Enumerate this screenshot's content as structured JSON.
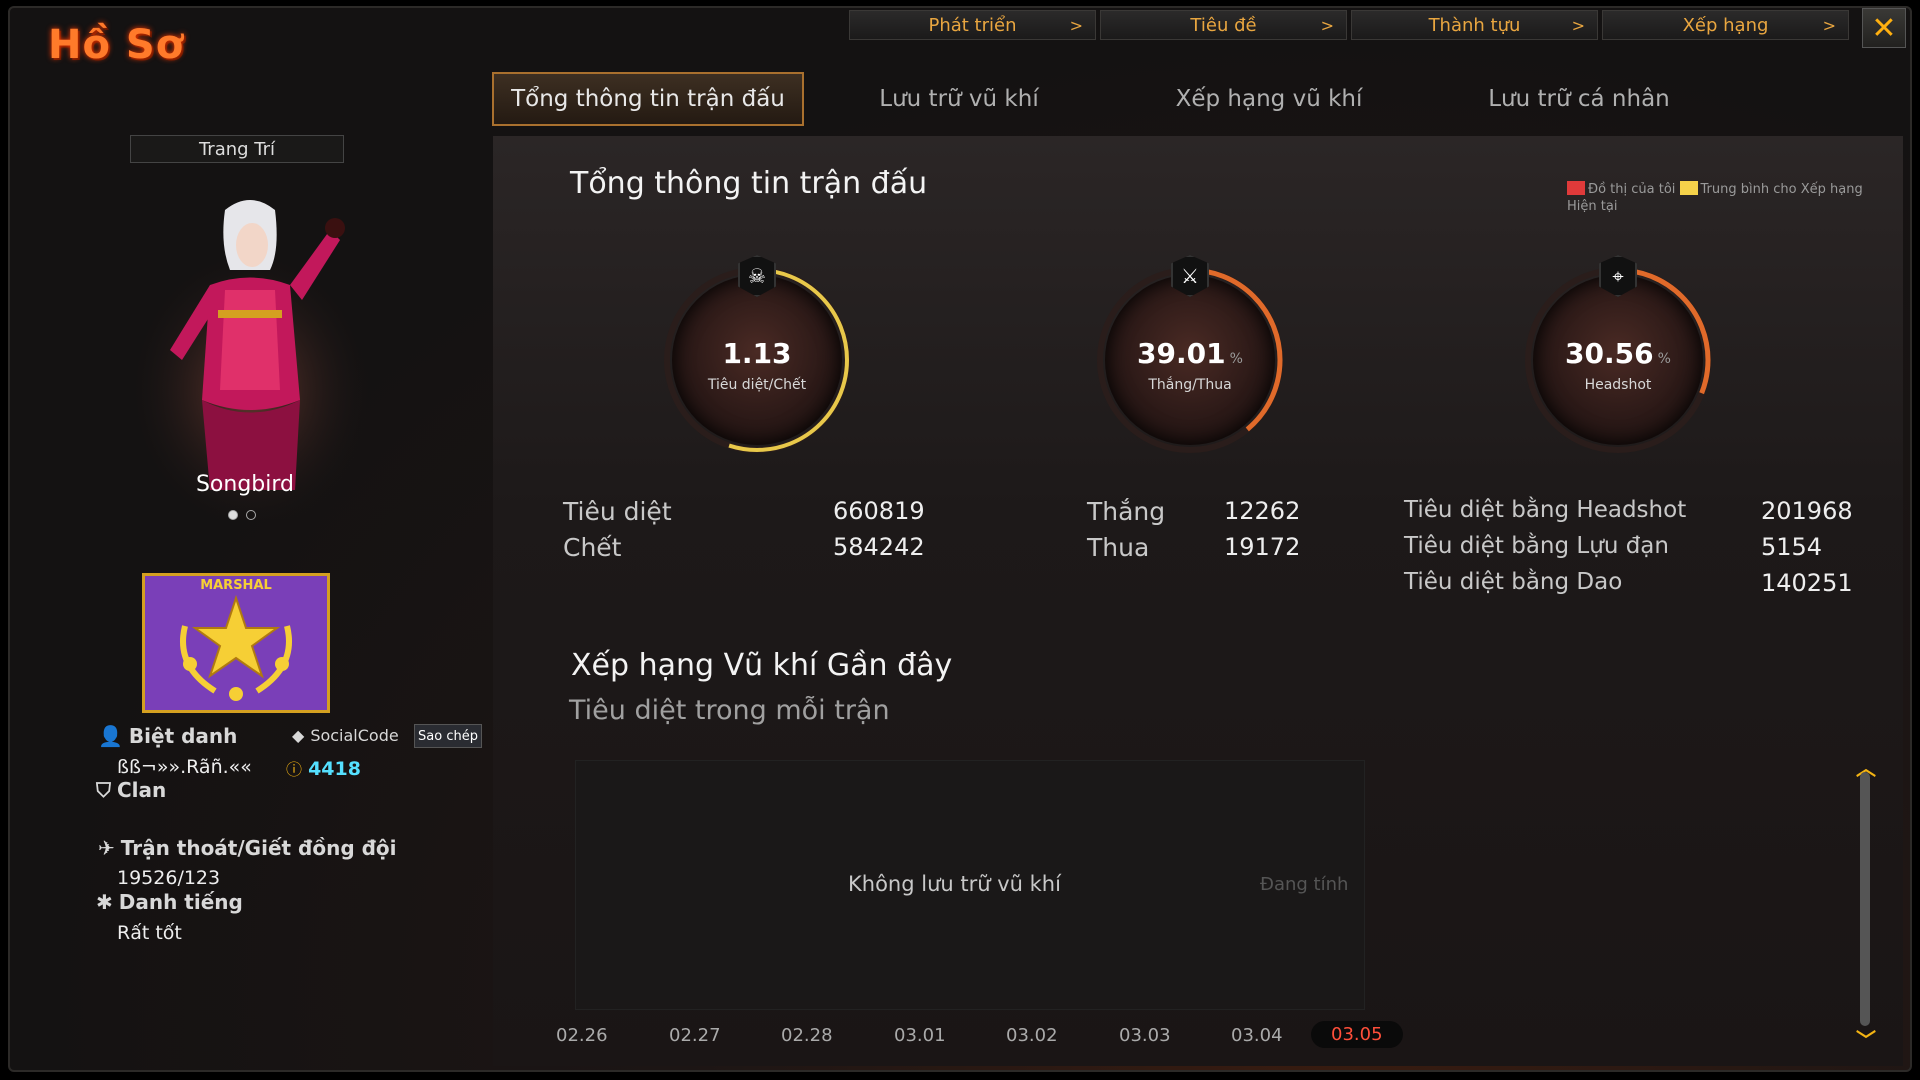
{
  "window": {
    "title": "Hồ Sơ",
    "close_label": "✕"
  },
  "topnav": [
    {
      "label": "Phát triển"
    },
    {
      "label": "Tiêu đề"
    },
    {
      "label": "Thành tựu"
    },
    {
      "label": "Xếp hạng"
    }
  ],
  "tabs": [
    {
      "label": "Tổng thông tin trận đấu",
      "active": true
    },
    {
      "label": "Lưu trữ vũ khí"
    },
    {
      "label": "Xếp hạng vũ khí"
    },
    {
      "label": "Lưu trữ cá nhân"
    }
  ],
  "profile": {
    "decorate_button": "Trang Trí",
    "character_name": "Songbird",
    "rank_badge": "MARSHAL",
    "nickname_label": "Biệt danh",
    "nickname": "ßß¬»».Rãñ.««",
    "socialcode_label": "SocialCode",
    "copy_label": "Sao chép",
    "socialcode": "4418",
    "clan_label": "Clan",
    "escape_label": "Trận thoát/Giết đồng đội",
    "escape_value": "19526/123",
    "reputation_label": "Danh tiếng",
    "reputation_value": "Rất tốt"
  },
  "summary": {
    "title": "Tổng thông tin trận đấu",
    "legend": {
      "mine": "Đồ thị của tôi",
      "avg": "Trung bình cho Xếp hạng Hiện tại",
      "mine_color": "#e03a3a",
      "avg_color": "#f5d24a"
    },
    "gauges": [
      {
        "value": "1.13",
        "pct": "",
        "label": "Tiêu diệt/Chết",
        "icon": "skull-icon",
        "glyph": "☠",
        "fill": 0.55
      },
      {
        "value": "39.01",
        "pct": "%",
        "label": "Thắng/Thua",
        "icon": "crossed-swords-icon",
        "glyph": "⚔",
        "fill": 0.39
      },
      {
        "value": "30.56",
        "pct": "%",
        "label": "Headshot",
        "icon": "crosshair-icon",
        "glyph": "⌖",
        "fill": 0.31
      }
    ],
    "stats_kill": {
      "l1": "Tiêu diệt",
      "v1": "660819",
      "l2": "Chết",
      "v2": "584242"
    },
    "stats_win": {
      "l1": "Thắng",
      "v1": "12262",
      "l2": "Thua",
      "v2": "19172"
    },
    "stats_head": {
      "l1": "Tiêu diệt bằng Headshot",
      "v1": "201968",
      "l2": "Tiêu diệt bằng Lựu đạn",
      "v2": "5154",
      "l3": "Tiêu diệt bằng Dao",
      "v3": "140251"
    }
  },
  "weapons": {
    "title": "Xếp hạng Vũ khí Gần đây",
    "subtitle": "Tiêu diệt trong mỗi trận",
    "empty": "Không lưu trữ vũ khí",
    "calculating": "Đang tính",
    "dates": [
      "02.26",
      "02.27",
      "02.28",
      "03.01",
      "03.02",
      "03.03",
      "03.04",
      "03.05"
    ],
    "active_date": "03.05"
  }
}
